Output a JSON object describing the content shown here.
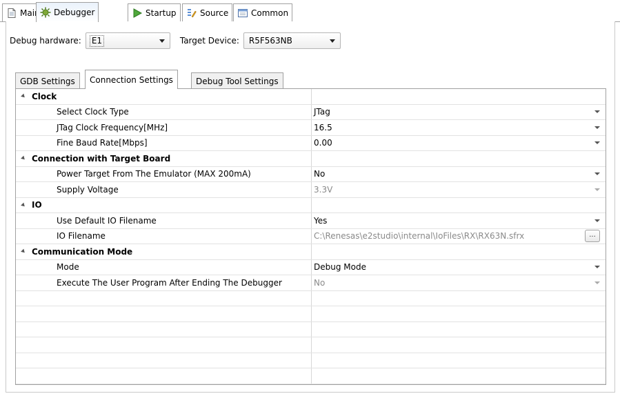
{
  "top_tabs": [
    {
      "label": "Main",
      "icon": "document-icon"
    },
    {
      "label": "Debugger",
      "icon": "gear-bug-icon"
    },
    {
      "label": "Startup",
      "icon": "play-icon"
    },
    {
      "label": "Source",
      "icon": "source-icon"
    },
    {
      "label": "Common",
      "icon": "common-icon"
    }
  ],
  "hardware": {
    "debug_hardware_label": "Debug hardware:",
    "debug_hardware_value": "E1",
    "target_device_label": "Target Device:",
    "target_device_value": "R5F563NB"
  },
  "inner_tabs": [
    {
      "label": "GDB Settings"
    },
    {
      "label": "Connection Settings"
    },
    {
      "label": "Debug Tool Settings"
    }
  ],
  "table": {
    "rows": [
      {
        "type": "category",
        "name": "Clock"
      },
      {
        "type": "property",
        "name": "Select Clock Type",
        "value": "JTag"
      },
      {
        "type": "property",
        "name": "JTag Clock Frequency[MHz]",
        "value": "16.5"
      },
      {
        "type": "property",
        "name": "Fine Baud Rate[Mbps]",
        "value": "0.00"
      },
      {
        "type": "category",
        "name": "Connection with Target Board"
      },
      {
        "type": "property",
        "name": "Power Target From The Emulator (MAX 200mA)",
        "value": "No"
      },
      {
        "type": "property",
        "name": "Supply Voltage",
        "value": "3.3V"
      },
      {
        "type": "category",
        "name": "IO"
      },
      {
        "type": "property",
        "name": "Use Default IO Filename",
        "value": "Yes"
      },
      {
        "type": "property",
        "name": "IO Filename",
        "value": "C:\\Renesas\\e2studio\\internal\\IoFiles\\RX\\RX63N.sfrx"
      },
      {
        "type": "category",
        "name": "Communication Mode"
      },
      {
        "type": "property",
        "name": "Mode",
        "value": "Debug Mode"
      },
      {
        "type": "property",
        "name": "Execute The User Program After Ending The Debugger",
        "value": "No"
      }
    ],
    "browse_label": "..."
  }
}
